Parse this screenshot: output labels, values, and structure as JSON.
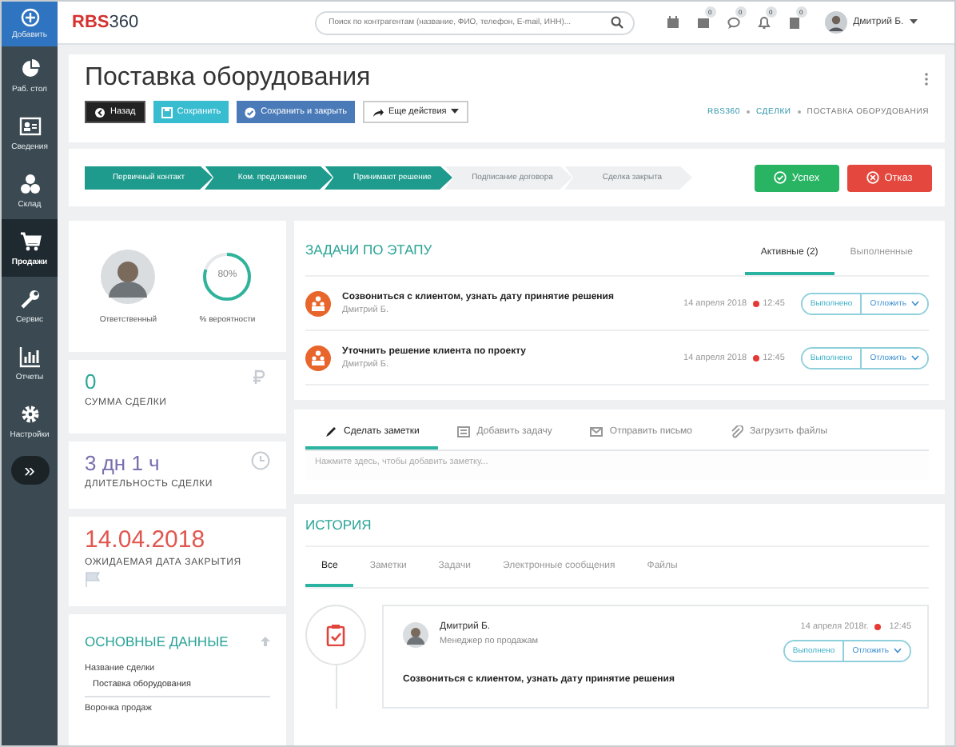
{
  "sidebar": {
    "add": {
      "label": "Добавить"
    },
    "items": [
      {
        "label": "Раб. стол",
        "selected": false
      },
      {
        "label": "Сведения",
        "selected": false
      },
      {
        "label": "Склад",
        "selected": false
      },
      {
        "label": "Продажи",
        "selected": true
      },
      {
        "label": "Сервис",
        "selected": false
      },
      {
        "label": "Отчеты",
        "selected": false
      },
      {
        "label": "Настройки",
        "selected": false
      }
    ],
    "expand": "»"
  },
  "topbar": {
    "logo": {
      "brand": "RBS",
      "suffix": "360"
    },
    "search": {
      "placeholder": "Поиск по контрагентам (название, ФИО, телефон, E-mail, ИНН)..."
    },
    "badges": [
      "0",
      "0",
      "0",
      "0"
    ],
    "user": "Дмитрий Б."
  },
  "header": {
    "title": "Поставка оборудования",
    "buttons": [
      {
        "kind": "back",
        "label": "Назад"
      },
      {
        "kind": "save",
        "label": "Сохранить"
      },
      {
        "kind": "save_close",
        "label": "Сохранить и закрыть"
      },
      {
        "kind": "more",
        "label": "Еще действия"
      }
    ],
    "breadcrumb": [
      {
        "label": "RBS360",
        "current": false
      },
      {
        "label": "СДЕЛКИ",
        "current": false
      },
      {
        "label": "ПОСТАВКА ОБОРУДОВАНИЯ",
        "current": true
      }
    ]
  },
  "pipeline": {
    "stages": [
      {
        "label": "Первичный контакт",
        "done": true
      },
      {
        "label": "Ком. предложение",
        "done": true
      },
      {
        "label": "Принимают решение",
        "done": true
      },
      {
        "label": "Подписание договора",
        "done": false
      },
      {
        "label": "Сделка закрыта",
        "done": false
      }
    ],
    "success": "Успех",
    "failure": "Отказ"
  },
  "summary": {
    "responsible": "Ответственный",
    "probability": {
      "value": "80%",
      "label": "% вероятности"
    }
  },
  "metrics": [
    {
      "value": "0",
      "label": "СУММА СДЕЛКИ",
      "color": "#2fa89a"
    },
    {
      "value": "3 дн 1 ч",
      "label": "ДЛИТЕЛЬНОСТЬ СДЕЛКИ",
      "color": "#7b6fb0"
    },
    {
      "value": "14.04.2018",
      "label": "ОЖИДАЕМАЯ ДАТА ЗАКРЫТИЯ",
      "color": "#e0574f"
    }
  ],
  "main_data": {
    "title": "ОСНОВНЫЕ ДАННЫЕ",
    "fields": [
      {
        "label": "Название сделки",
        "value": "Поставка оборудования"
      },
      {
        "label": "Воронка продаж"
      }
    ]
  },
  "tasks": {
    "title": "ЗАДАЧИ ПО ЭТАПУ",
    "tabs": [
      {
        "label": "Активные (2)",
        "selected": true
      },
      {
        "label": "Выполненные",
        "selected": false
      }
    ],
    "items": [
      {
        "title": "Созвониться с клиентом, узнать дату принятие решения",
        "author": "Дмитрий Б.",
        "date": "14 апреля 2018",
        "time": "12:45",
        "done_label": "Выполнено",
        "postpone_label": "Отложить"
      },
      {
        "title": "Уточнить решение клиента по проекту",
        "author": "Дмитрий Б.",
        "date": "14 апреля 2018",
        "time": "12:45",
        "done_label": "Выполнено",
        "postpone_label": "Отложить"
      }
    ]
  },
  "notes": {
    "tabs": [
      {
        "label": "Сделать заметки",
        "selected": true
      },
      {
        "label": "Добавить задачу",
        "selected": false
      },
      {
        "label": "Отправить письмо",
        "selected": false
      },
      {
        "label": "Загрузить файлы",
        "selected": false
      }
    ],
    "placeholder": "Нажмите здесь, чтобы добавить заметку..."
  },
  "history": {
    "title": "ИСТОРИЯ",
    "tabs": [
      {
        "label": "Все",
        "selected": true
      },
      {
        "label": "Заметки",
        "selected": false
      },
      {
        "label": "Задачи",
        "selected": false
      },
      {
        "label": "Электронные сообщения",
        "selected": false
      },
      {
        "label": "Файлы",
        "selected": false
      }
    ],
    "entries": [
      {
        "author": "Дмитрий Б.",
        "role": "Менеджер по продажам",
        "date": "14 апреля 2018г.",
        "time": "12:45",
        "text": "Созвониться с клиентом, узнать дату принятие решения",
        "done_label": "Выполнено",
        "postpone_label": "Отложить"
      }
    ]
  }
}
